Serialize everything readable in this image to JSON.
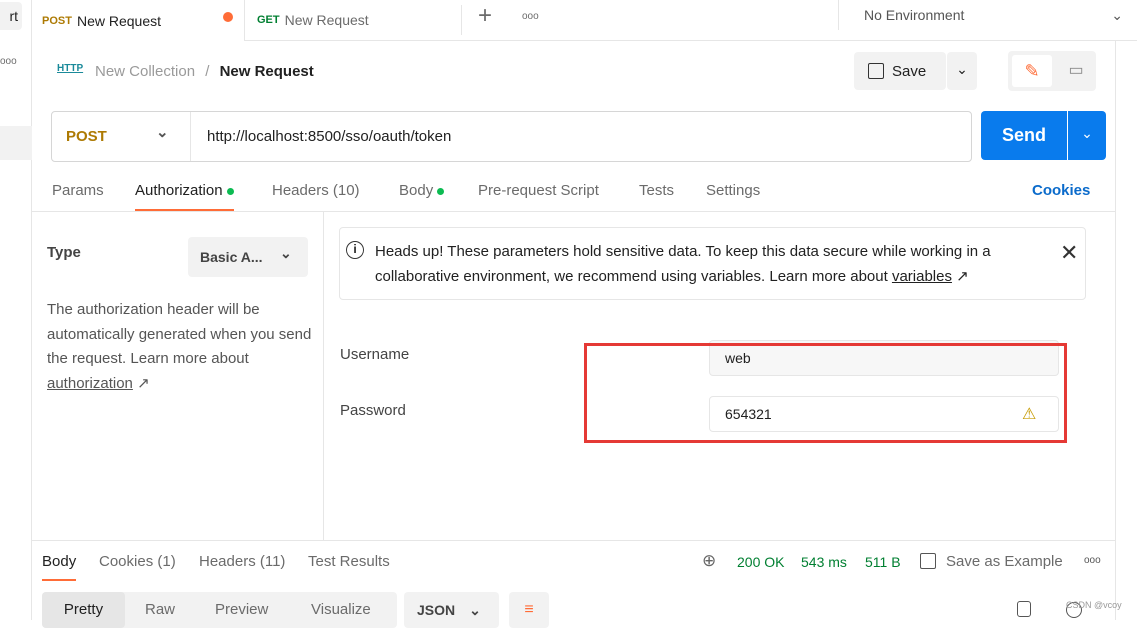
{
  "sidebar": {
    "button_fragment": "rt"
  },
  "tabs": [
    {
      "method": "POST",
      "label": "New Request",
      "unsaved": true
    },
    {
      "method": "GET",
      "label": "New Request"
    }
  ],
  "environment": "No Environment",
  "breadcrumb": {
    "collection": "New Collection",
    "separator": "/",
    "request": "New Request"
  },
  "save_label": "Save",
  "request": {
    "method": "POST",
    "url": "http://localhost:8500/sso/oauth/token"
  },
  "send_label": "Send",
  "req_tabs": [
    "Params",
    "Authorization",
    "Headers (10)",
    "Body",
    "Pre-request Script",
    "Tests",
    "Settings"
  ],
  "cookies_label": "Cookies",
  "auth": {
    "type_label": "Type",
    "type_value": "Basic A...",
    "desc": "The authorization header will be automatically generated when you send the request. Learn more about ",
    "desc_link": "authorization",
    "desc_arrow": "↗",
    "banner": "Heads up! These parameters hold sensitive data. To keep this data secure while working in a collaborative environment, we recommend using variables. Learn more about ",
    "banner_link": "variables",
    "banner_arrow": "↗",
    "username_label": "Username",
    "username": "web",
    "password_label": "Password",
    "password": "654321"
  },
  "resp_tabs": [
    "Body",
    "Cookies (1)",
    "Headers (11)",
    "Test Results"
  ],
  "response": {
    "status": "200 OK",
    "time": "543 ms",
    "size": "511 B",
    "save_example": "Save as Example"
  },
  "view_tabs": [
    "Pretty",
    "Raw",
    "Preview",
    "Visualize"
  ],
  "format": "JSON",
  "watermark": "CSDN @vcoy",
  "colors": {
    "accent": "#ff6c37",
    "send": "#097bed",
    "post": "#ad7a03",
    "get": "#007f31",
    "status": "#007f31",
    "highlight": "#e53935"
  }
}
